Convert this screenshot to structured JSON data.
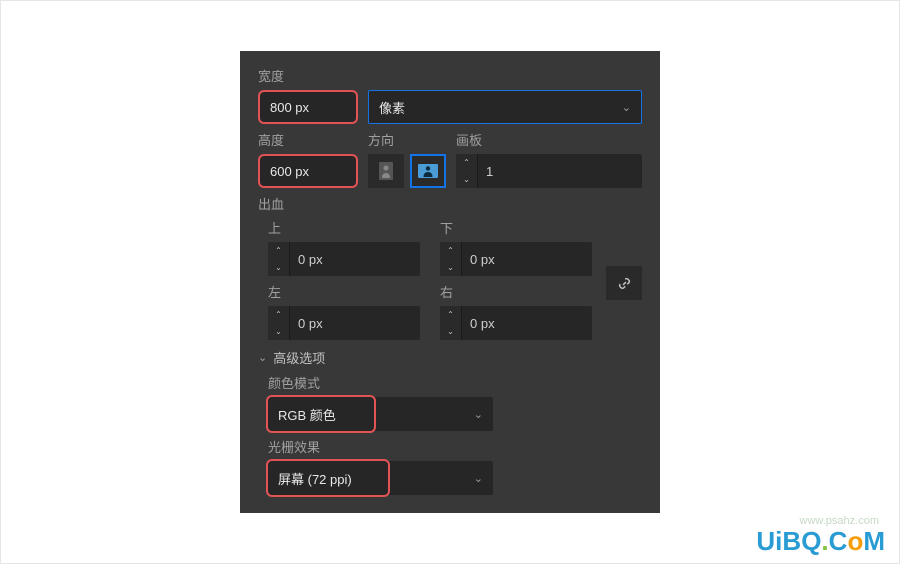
{
  "labels": {
    "width": "宽度",
    "height": "高度",
    "orientation": "方向",
    "artboards": "画板",
    "bleed": "出血",
    "top": "上",
    "bottom": "下",
    "left": "左",
    "right": "右",
    "advanced": "高级选项",
    "color_mode": "颜色模式",
    "raster_effects": "光栅效果"
  },
  "values": {
    "width": "800 px",
    "height": "600 px",
    "units": "像素",
    "artboards": "1",
    "bleed_top": "0 px",
    "bleed_bottom": "0 px",
    "bleed_left": "0 px",
    "bleed_right": "0 px",
    "color_mode": "RGB 颜色",
    "raster_effects": "屏幕 (72 ppi)"
  },
  "watermark": {
    "sub": "www.psahz.com",
    "text": "UiBQ.CoM"
  }
}
